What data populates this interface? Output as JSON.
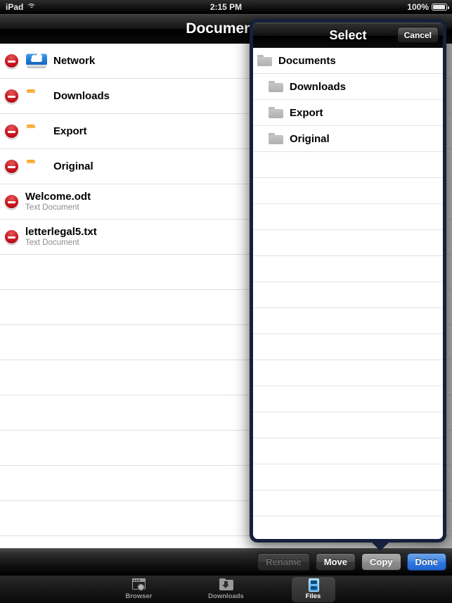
{
  "status_bar": {
    "device": "iPad",
    "wifi_icon": "wifi-icon",
    "time": "2:15 PM",
    "battery_percent": "100%",
    "battery_icon": "battery-icon"
  },
  "nav_bar": {
    "title": "Documents"
  },
  "file_list": {
    "rows": [
      {
        "name": "Network",
        "subtitle": "",
        "icon": "network-drive-icon",
        "type": "drive",
        "delete_icon": "delete-minus-icon"
      },
      {
        "name": "Downloads",
        "subtitle": "",
        "icon": "folder-icon",
        "type": "folder",
        "delete_icon": "delete-minus-icon"
      },
      {
        "name": "Export",
        "subtitle": "",
        "icon": "folder-icon",
        "type": "folder",
        "delete_icon": "delete-minus-icon"
      },
      {
        "name": "Original",
        "subtitle": "",
        "icon": "folder-icon",
        "type": "folder",
        "delete_icon": "delete-minus-icon"
      },
      {
        "name": "Welcome.odt",
        "subtitle": "Text Document",
        "icon": "",
        "type": "file",
        "delete_icon": "delete-minus-icon"
      },
      {
        "name": "letterlegal5.txt",
        "subtitle": "Text Document",
        "icon": "",
        "type": "file",
        "delete_icon": "delete-minus-icon"
      }
    ],
    "empty_row_count": 9
  },
  "popover": {
    "title": "Select",
    "cancel_label": "Cancel",
    "rows": [
      {
        "label": "Documents",
        "indent": 0,
        "icon": "folder-icon"
      },
      {
        "label": "Downloads",
        "indent": 1,
        "icon": "folder-icon"
      },
      {
        "label": "Export",
        "indent": 1,
        "icon": "folder-icon"
      },
      {
        "label": "Original",
        "indent": 1,
        "icon": "folder-icon"
      }
    ],
    "empty_row_count": 15
  },
  "bottom_toolbar": {
    "buttons": [
      {
        "label": "Rename",
        "state": "disabled"
      },
      {
        "label": "Move",
        "state": "normal"
      },
      {
        "label": "Copy",
        "state": "active"
      },
      {
        "label": "Done",
        "state": "primary"
      }
    ]
  },
  "tab_bar": {
    "tabs": [
      {
        "label": "Browser",
        "icon": "browser-globe-icon",
        "selected": false
      },
      {
        "label": "Downloads",
        "icon": "folder-download-icon",
        "selected": false
      },
      {
        "label": "Files",
        "icon": "file-cabinet-icon",
        "selected": true
      }
    ]
  },
  "colors": {
    "accent_blue": "#2f79e2",
    "popover_border": "#16203c",
    "delete_red": "#c8141c"
  }
}
